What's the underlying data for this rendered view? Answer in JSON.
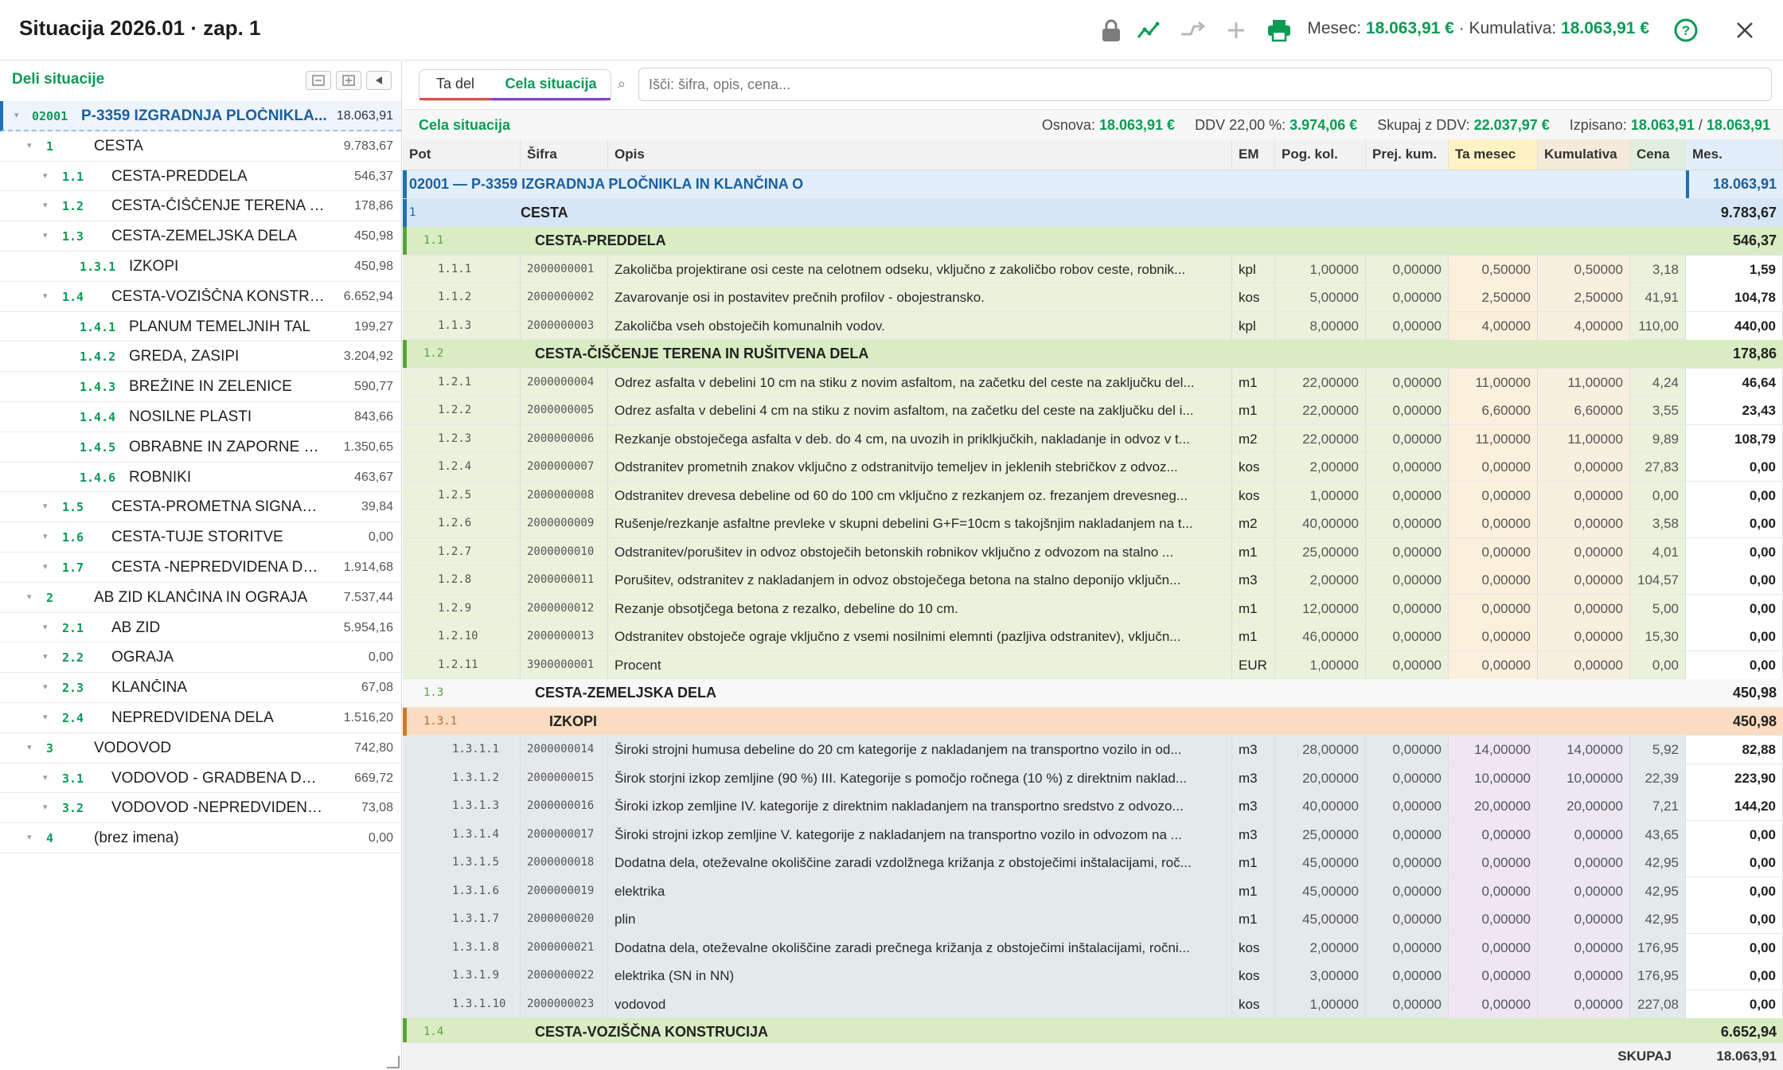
{
  "header": {
    "title": "Situacija 2026.01 · zap. 1",
    "summary_month_label": "Mesec:",
    "summary_month": "18.063,91 €",
    "summary_sep": " · ",
    "summary_cum_label": "Kumulativa:",
    "summary_cum": "18.063,91 €"
  },
  "icons": [
    "lock-icon",
    "chart-icon",
    "split-icon",
    "plus-icon",
    "print-icon",
    "help-icon",
    "close-icon"
  ],
  "left": {
    "title": "Deli situacije",
    "tree": [
      {
        "level": 0,
        "code": "02001",
        "label": "P-3359 IZGRADNJA PLOČNIKLA...",
        "value": "18.063,91",
        "root": true,
        "caret": true
      },
      {
        "level": 1,
        "code": "1",
        "label": "CESTA",
        "value": "9.783,67",
        "caret": true
      },
      {
        "level": 2,
        "code": "1.1",
        "label": "CESTA-PREDDELA",
        "value": "546,37",
        "caret": true
      },
      {
        "level": 2,
        "code": "1.2",
        "label": "CESTA-ČIŠČENJE TERENA IN RUŠ...",
        "value": "178,86",
        "caret": true
      },
      {
        "level": 2,
        "code": "1.3",
        "label": "CESTA-ZEMELJSKA DELA",
        "value": "450,98",
        "caret": true
      },
      {
        "level": 3,
        "code": "1.3.1",
        "label": "IZKOPI",
        "value": "450,98",
        "caret": false
      },
      {
        "level": 2,
        "code": "1.4",
        "label": "CESTA-VOZIŠČNA KONSTRUCIJA",
        "value": "6.652,94",
        "caret": true
      },
      {
        "level": 3,
        "code": "1.4.1",
        "label": "PLANUM TEMELJNIH TAL",
        "value": "199,27",
        "caret": false
      },
      {
        "level": 3,
        "code": "1.4.2",
        "label": "GREDA, ZASIPI",
        "value": "3.204,92",
        "caret": false
      },
      {
        "level": 3,
        "code": "1.4.3",
        "label": "BREŽINE IN ZELENICE",
        "value": "590,77",
        "caret": false
      },
      {
        "level": 3,
        "code": "1.4.4",
        "label": "NOSILNE PLASTI",
        "value": "843,66",
        "caret": false
      },
      {
        "level": 3,
        "code": "1.4.5",
        "label": "OBRABNE IN ZAPORNE PLA...",
        "value": "1.350,65",
        "caret": false
      },
      {
        "level": 3,
        "code": "1.4.6",
        "label": "ROBNIKI",
        "value": "463,67",
        "caret": false
      },
      {
        "level": 2,
        "code": "1.5",
        "label": "CESTA-PROMETNA SIGNALIZACIJA",
        "value": "39,84",
        "caret": true
      },
      {
        "level": 2,
        "code": "1.6",
        "label": "CESTA-TUJE STORITVE",
        "value": "0,00",
        "caret": true
      },
      {
        "level": 2,
        "code": "1.7",
        "label": "CESTA -NEPREDVIDENA DELA",
        "value": "1.914,68",
        "caret": true
      },
      {
        "level": 1,
        "code": "2",
        "label": "AB ZID KLANČINA IN OGRAJA",
        "value": "7.537,44",
        "caret": true
      },
      {
        "level": 2,
        "code": "2.1",
        "label": "AB ZID",
        "value": "5.954,16",
        "caret": true
      },
      {
        "level": 2,
        "code": "2.2",
        "label": "OGRAJA",
        "value": "0,00",
        "caret": true
      },
      {
        "level": 2,
        "code": "2.3",
        "label": "KLANČINA",
        "value": "67,08",
        "caret": true
      },
      {
        "level": 2,
        "code": "2.4",
        "label": "NEPREDVIDENA DELA",
        "value": "1.516,20",
        "caret": true
      },
      {
        "level": 1,
        "code": "3",
        "label": "VODOVOD",
        "value": "742,80",
        "caret": true
      },
      {
        "level": 2,
        "code": "3.1",
        "label": "VODOVOD - GRADBENA DELA",
        "value": "669,72",
        "caret": true
      },
      {
        "level": 2,
        "code": "3.2",
        "label": "VODOVOD -NEPREDVIDENA DELA",
        "value": "73,08",
        "caret": true
      },
      {
        "level": 1,
        "code": "4",
        "label": "(brez imena)",
        "value": "0,00",
        "caret": true
      }
    ]
  },
  "tabs": {
    "tab1": "Ta del",
    "tab2": "Cela situacija"
  },
  "search": {
    "placeholder": "Išči: šifra, opis, cena..."
  },
  "summary": {
    "label": "Cela situacija",
    "osnova_label": "Osnova:",
    "osnova": "18.063,91 €",
    "ddv_label": "DDV 22,00 %:",
    "ddv": "3.974,06 €",
    "skupaj_label": "Skupaj z DDV:",
    "skupaj": "22.037,97 €",
    "izpisano_label": "Izpisano:",
    "izpisano": "18.063,91",
    "izpisano_sep": " / ",
    "izpisano_total": "18.063,91"
  },
  "columns": [
    "Pot",
    "Šifra",
    "Opis",
    "EM",
    "Pog. kol.",
    "Prej. kum.",
    "Ta mesec",
    "Kumulativa",
    "Cena",
    "Mes. vrednost"
  ],
  "rows": [
    {
      "type": "root",
      "text": "02001 — P-3359 IZGRADNJA PLOČNIKLA IN KLANČINA O",
      "mv": "18.063,91"
    },
    {
      "type": "g1",
      "pot": "1",
      "text": "CESTA",
      "mv": "9.783,67"
    },
    {
      "type": "g2",
      "pot": "1.1",
      "text": "CESTA-PREDDELA",
      "mv": "546,37"
    },
    {
      "type": "item",
      "shade": "g2",
      "pot": "1.1.1",
      "sif": "2000000001",
      "opis": "Zakoličba projektirane osi ceste na celotnem odseku, vključno z zakoličbo robov ceste, robnik...",
      "em": "kpl",
      "pog": "1,00000",
      "prej": "0,00000",
      "ta": "0,50000",
      "kum": "0,50000",
      "cena": "3,18",
      "mv": "1,59"
    },
    {
      "type": "item",
      "shade": "g2",
      "pot": "1.1.2",
      "sif": "2000000002",
      "opis": "Zavarovanje osi in postavitev prečnih profilov - obojestransko.",
      "em": "kos",
      "pog": "5,00000",
      "prej": "0,00000",
      "ta": "2,50000",
      "kum": "2,50000",
      "cena": "41,91",
      "mv": "104,78"
    },
    {
      "type": "item",
      "shade": "g2",
      "pot": "1.1.3",
      "sif": "2000000003",
      "opis": "Zakoličba vseh obstoječih komunalnih vodov.",
      "em": "kpl",
      "pog": "8,00000",
      "prej": "0,00000",
      "ta": "4,00000",
      "kum": "4,00000",
      "cena": "110,00",
      "mv": "440,00"
    },
    {
      "type": "g2",
      "pot": "1.2",
      "text": "CESTA-ČIŠČENJE TERENA IN RUŠITVENA DELA",
      "mv": "178,86"
    },
    {
      "type": "item",
      "shade": "g2",
      "pot": "1.2.1",
      "sif": "2000000004",
      "opis": "Odrez asfalta v debelini 10 cm na stiku z novim asfaltom, na začetku del ceste na zaključku del...",
      "em": "m1",
      "pog": "22,00000",
      "prej": "0,00000",
      "ta": "11,00000",
      "kum": "11,00000",
      "cena": "4,24",
      "mv": "46,64"
    },
    {
      "type": "item",
      "shade": "g2",
      "pot": "1.2.2",
      "sif": "2000000005",
      "opis": "Odrez asfalta v debelini 4 cm na stiku z novim asfaltom, na začetku del ceste na zaključku del i...",
      "em": "m1",
      "pog": "22,00000",
      "prej": "0,00000",
      "ta": "6,60000",
      "kum": "6,60000",
      "cena": "3,55",
      "mv": "23,43"
    },
    {
      "type": "item",
      "shade": "g2",
      "pot": "1.2.3",
      "sif": "2000000006",
      "opis": "Rezkanje obstoječega asfalta v deb. do 4 cm, na uvozih in priklkjučkih, nakladanje in odvoz v t...",
      "em": "m2",
      "pog": "22,00000",
      "prej": "0,00000",
      "ta": "11,00000",
      "kum": "11,00000",
      "cena": "9,89",
      "mv": "108,79"
    },
    {
      "type": "item",
      "shade": "g2",
      "pot": "1.2.4",
      "sif": "2000000007",
      "opis": "Odstranitev prometnih znakov vključno z odstranitvijo temeljev in jeklenih stebričkov z odvoz...",
      "em": "kos",
      "pog": "2,00000",
      "prej": "0,00000",
      "ta": "0,00000",
      "kum": "0,00000",
      "cena": "27,83",
      "mv": "0,00"
    },
    {
      "type": "item",
      "shade": "g2",
      "pot": "1.2.5",
      "sif": "2000000008",
      "opis": "Odstranitev drevesa debeline od 60 do 100 cm vključno z rezkanjem oz. frezanjem drevesneg...",
      "em": "kos",
      "pog": "1,00000",
      "prej": "0,00000",
      "ta": "0,00000",
      "kum": "0,00000",
      "cena": "0,00",
      "mv": "0,00"
    },
    {
      "type": "item",
      "shade": "g2",
      "pot": "1.2.6",
      "sif": "2000000009",
      "opis": "Rušenje/rezkanje asfaltne prevleke v skupni debelini G+F=10cm s takojšnjim nakladanjem na t...",
      "em": "m2",
      "pog": "40,00000",
      "prej": "0,00000",
      "ta": "0,00000",
      "kum": "0,00000",
      "cena": "3,58",
      "mv": "0,00"
    },
    {
      "type": "item",
      "shade": "g2",
      "pot": "1.2.7",
      "sif": "2000000010",
      "opis": "Odstranitev/porušitev in odvoz obstoječih betonskih robnikov vključno z odvozom na stalno ...",
      "em": "m1",
      "pog": "25,00000",
      "prej": "0,00000",
      "ta": "0,00000",
      "kum": "0,00000",
      "cena": "4,01",
      "mv": "0,00"
    },
    {
      "type": "item",
      "shade": "g2",
      "pot": "1.2.8",
      "sif": "2000000011",
      "opis": "Porušitev, odstranitev z nakladanjem in odvoz obstoječega betona na stalno deponijo vključn...",
      "em": "m3",
      "pog": "2,00000",
      "prej": "0,00000",
      "ta": "0,00000",
      "kum": "0,00000",
      "cena": "104,57",
      "mv": "0,00"
    },
    {
      "type": "item",
      "shade": "g2",
      "pot": "1.2.9",
      "sif": "2000000012",
      "opis": "Rezanje obsotjčega betona z rezalko, debeline do 10 cm.",
      "em": "m1",
      "pog": "12,00000",
      "prej": "0,00000",
      "ta": "0,00000",
      "kum": "0,00000",
      "cena": "5,00",
      "mv": "0,00"
    },
    {
      "type": "item",
      "shade": "g2",
      "pot": "1.2.10",
      "sif": "2000000013",
      "opis": "Odstranitev obstoječe ograje vključno z vsemi nosilnimi elemnti (pazljiva odstranitev), vključn...",
      "em": "m1",
      "pog": "46,00000",
      "prej": "0,00000",
      "ta": "0,00000",
      "kum": "0,00000",
      "cena": "15,30",
      "mv": "0,00"
    },
    {
      "type": "item",
      "shade": "g2",
      "pot": "1.2.11",
      "sif": "3900000001",
      "opis": "Procent",
      "em": "EUR",
      "pog": "1,00000",
      "prej": "0,00000",
      "ta": "0,00000",
      "kum": "0,00000",
      "cena": "0,00",
      "mv": "0,00"
    },
    {
      "type": "g2w",
      "pot": "1.3",
      "text": "CESTA-ZEMELJSKA DELA",
      "mv": "450,98"
    },
    {
      "type": "g3",
      "pot": "1.3.1",
      "text": "IZKOPI",
      "mv": "450,98"
    },
    {
      "type": "item",
      "shade": "g3",
      "pot": "1.3.1.1",
      "sif": "2000000014",
      "opis": "Široki strojni humusa debeline do 20 cm kategorije z nakladanjem na transportno vozilo in od...",
      "em": "m3",
      "pog": "28,00000",
      "prej": "0,00000",
      "ta": "14,00000",
      "kum": "14,00000",
      "cena": "5,92",
      "mv": "82,88"
    },
    {
      "type": "item",
      "shade": "g3",
      "pot": "1.3.1.2",
      "sif": "2000000015",
      "opis": "Širok storjni izkop zemljine (90 %) III. Kategorije s pomočjo ročnega (10 %) z direktnim naklad...",
      "em": "m3",
      "pog": "20,00000",
      "prej": "0,00000",
      "ta": "10,00000",
      "kum": "10,00000",
      "cena": "22,39",
      "mv": "223,90"
    },
    {
      "type": "item",
      "shade": "g3",
      "pot": "1.3.1.3",
      "sif": "2000000016",
      "opis": "Široki izkop zemljine IV. kategorije z direktnim nakladanjem na transportno sredstvo z odvozo...",
      "em": "m3",
      "pog": "40,00000",
      "prej": "0,00000",
      "ta": "20,00000",
      "kum": "20,00000",
      "cena": "7,21",
      "mv": "144,20"
    },
    {
      "type": "item",
      "shade": "g3",
      "pot": "1.3.1.4",
      "sif": "2000000017",
      "opis": "Široki strojni izkop zemljine V. kategorije z nakladanjem na transportno vozilo in odvozom na ...",
      "em": "m3",
      "pog": "25,00000",
      "prej": "0,00000",
      "ta": "0,00000",
      "kum": "0,00000",
      "cena": "43,65",
      "mv": "0,00"
    },
    {
      "type": "item",
      "shade": "g3",
      "pot": "1.3.1.5",
      "sif": "2000000018",
      "opis": "Dodatna dela, oteževalne okoliščine zaradi vzdolžnega križanja z obstoječimi inštalacijami, roč...",
      "em": "m1",
      "pog": "45,00000",
      "prej": "0,00000",
      "ta": "0,00000",
      "kum": "0,00000",
      "cena": "42,95",
      "mv": "0,00"
    },
    {
      "type": "item",
      "shade": "g3",
      "pot": "1.3.1.6",
      "sif": "2000000019",
      "opis": "elektrika",
      "em": "m1",
      "pog": "45,00000",
      "prej": "0,00000",
      "ta": "0,00000",
      "kum": "0,00000",
      "cena": "42,95",
      "mv": "0,00"
    },
    {
      "type": "item",
      "shade": "g3",
      "pot": "1.3.1.7",
      "sif": "2000000020",
      "opis": "plin",
      "em": "m1",
      "pog": "45,00000",
      "prej": "0,00000",
      "ta": "0,00000",
      "kum": "0,00000",
      "cena": "42,95",
      "mv": "0,00"
    },
    {
      "type": "item",
      "shade": "g3",
      "pot": "1.3.1.8",
      "sif": "2000000021",
      "opis": "Dodatna dela, oteževalne okoliščine zaradi prečnega križanja z obstoječimi inštalacijami, ročni...",
      "em": "kos",
      "pog": "2,00000",
      "prej": "0,00000",
      "ta": "0,00000",
      "kum": "0,00000",
      "cena": "176,95",
      "mv": "0,00"
    },
    {
      "type": "item",
      "shade": "g3",
      "pot": "1.3.1.9",
      "sif": "2000000022",
      "opis": "elektrika (SN in NN)",
      "em": "kos",
      "pog": "3,00000",
      "prej": "0,00000",
      "ta": "0,00000",
      "kum": "0,00000",
      "cena": "176,95",
      "mv": "0,00"
    },
    {
      "type": "item",
      "shade": "g3",
      "pot": "1.3.1.10",
      "sif": "2000000023",
      "opis": "vodovod",
      "em": "kos",
      "pog": "1,00000",
      "prej": "0,00000",
      "ta": "0,00000",
      "kum": "0,00000",
      "cena": "227,08",
      "mv": "0,00"
    },
    {
      "type": "g2",
      "pot": "1.4",
      "text": "CESTA-VOZIŠČNA KONSTRUCIJA",
      "mv": "6.652,94"
    }
  ],
  "footer": {
    "label": "SKUPAJ",
    "value": "18.063,91"
  },
  "colors": {
    "accent_green": "#0b9b55",
    "root_blue": "#1f6fb4",
    "tab1_underline": "#e34b4b",
    "tab2_underline": "#8b3fd1",
    "group_green": "#dcedc8",
    "group_orange": "#fbe3cc",
    "group_blue": "#dbe8f6"
  }
}
